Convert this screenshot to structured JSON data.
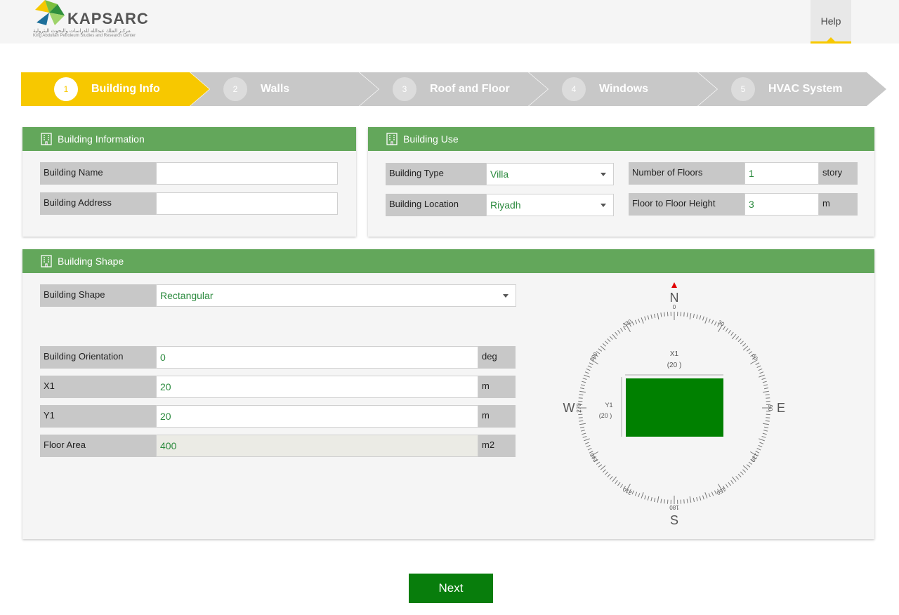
{
  "header": {
    "brand": "KAPSARC",
    "brand_arabic": "مركـز الملك عبدالله للدراسات والبحوث البترولية",
    "brand_subtitle": "King Abdullah Petroleum Studies and Research Center",
    "help_label": "Help"
  },
  "stepper": [
    {
      "num": "1",
      "label": "Building Info",
      "active": true
    },
    {
      "num": "2",
      "label": "Walls",
      "active": false
    },
    {
      "num": "3",
      "label": "Roof and Floor",
      "active": false
    },
    {
      "num": "4",
      "label": "Windows",
      "active": false
    },
    {
      "num": "5",
      "label": "HVAC System",
      "active": false
    }
  ],
  "building_info": {
    "title": "Building Information",
    "name_label": "Building Name",
    "name_value": "",
    "address_label": "Building Address",
    "address_value": ""
  },
  "building_use": {
    "title": "Building Use",
    "type_label": "Building Type",
    "type_value": "Villa",
    "location_label": "Building Location",
    "location_value": "Riyadh",
    "floors_label": "Number of Floors",
    "floors_value": "1",
    "floors_unit": "story",
    "height_label": "Floor to Floor Height",
    "height_value": "3",
    "height_unit": "m"
  },
  "building_shape": {
    "title": "Building Shape",
    "shape_label": "Building Shape",
    "shape_value": "Rectangular",
    "orientation_label": "Building Orientation",
    "orientation_value": "0",
    "orientation_unit": "deg",
    "x1_label": "X1",
    "x1_value": "20",
    "x1_unit": "m",
    "y1_label": "Y1",
    "y1_value": "20",
    "y1_unit": "m",
    "area_label": "Floor Area",
    "area_value": "400",
    "area_unit": "m2"
  },
  "compass": {
    "north": "N",
    "south": "S",
    "east": "E",
    "west": "W",
    "deg_0": "0",
    "deg_30": "30",
    "deg_60": "60",
    "deg_90": "90",
    "deg_120": "120",
    "deg_150": "150",
    "deg_180": "180",
    "deg_210": "210",
    "deg_240": "240",
    "deg_270": "270",
    "deg_300": "300",
    "deg_330": "330",
    "x_label": "X1",
    "x_value": "(20 )",
    "y_label": "Y1",
    "y_value": "(20 )",
    "building_color": "#008000",
    "north_marker_color": "#e00000"
  },
  "footer": {
    "next_label": "Next"
  },
  "colors": {
    "accent_yellow": "#f7c800",
    "panel_green": "#63a75b",
    "button_green": "#087d0c",
    "value_green": "#2b8a3e"
  }
}
